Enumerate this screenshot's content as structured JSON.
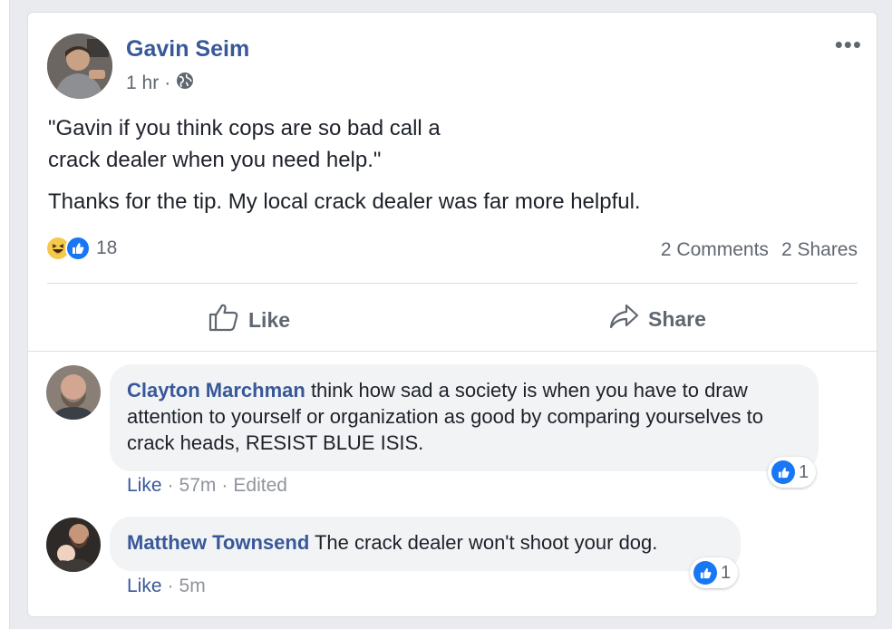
{
  "post": {
    "author": "Gavin Seim",
    "time": "1 hr",
    "separator": "·",
    "privacy_icon": "globe-icon",
    "text_quote_line1": "\"Gavin if you think cops are so bad call a",
    "text_quote_line2": "crack dealer when you need help.\"",
    "text_body": "Thanks for the tip. My local crack dealer was far more helpful.",
    "reactions": {
      "types": [
        "haha",
        "like"
      ],
      "count": "18"
    },
    "comments_count": "2 Comments",
    "shares_count": "2 Shares",
    "actions": {
      "like_label": "Like",
      "share_label": "Share"
    }
  },
  "comments": [
    {
      "author": "Clayton Marchman",
      "text": " think how sad a society is when you have to draw attention to yourself or organization as good by comparing yourselves to crack heads, RESIST BLUE ISIS.",
      "like_label": "Like",
      "time": "57m",
      "edited": "Edited",
      "reaction_count": "1"
    },
    {
      "author": "Matthew Townsend",
      "text": " The crack dealer won't shoot your dog.",
      "like_label": "Like",
      "time": "5m",
      "reaction_count": "1"
    }
  ],
  "colors": {
    "link_blue": "#385898",
    "like_blue": "#1877f2",
    "text_dark": "#1d2129",
    "text_gray": "#606770",
    "haha_yellow": "#f7c94b"
  }
}
